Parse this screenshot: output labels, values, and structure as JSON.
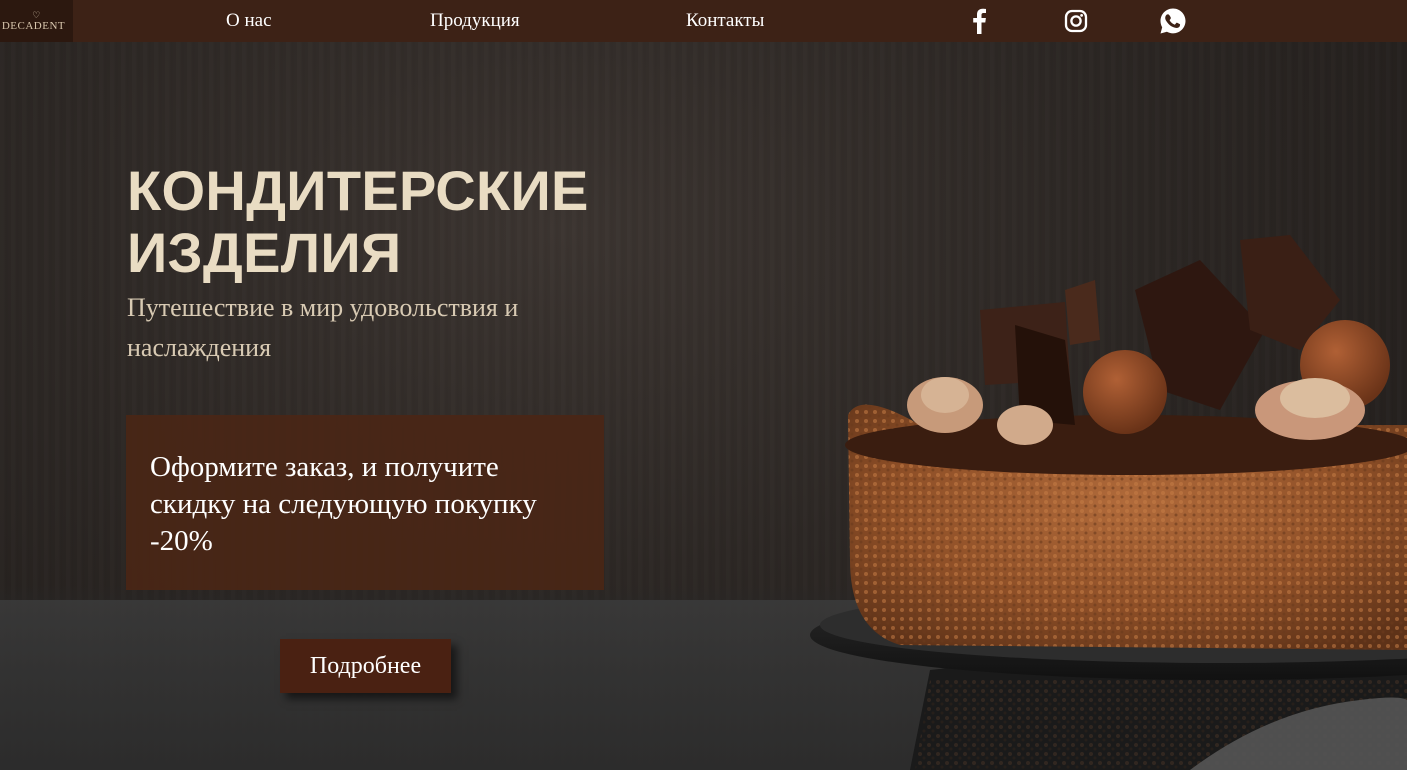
{
  "logo": {
    "text": "DECADENT"
  },
  "nav": {
    "links": [
      {
        "label": "О нас"
      },
      {
        "label": "Продукция"
      },
      {
        "label": "Контакты"
      }
    ],
    "social": [
      {
        "icon": "facebook-icon"
      },
      {
        "icon": "instagram-icon"
      },
      {
        "icon": "whatsapp-icon"
      }
    ]
  },
  "hero": {
    "title": "КОНДИТЕРСКИЕ\nИЗДЕЛИЯ",
    "subtitle": "Путешествие в мир удовольствия и наслаждения",
    "promo": "Оформите заказ, и получите скидку на следующую покупку -20%",
    "button_label": "Подробнее",
    "image": "chocolate-cake-image"
  },
  "colors": {
    "nav_bg": "#3d2216",
    "title": "#e9dcc3",
    "promo_bg": "#4a2616",
    "button_bg": "#4a2112"
  }
}
